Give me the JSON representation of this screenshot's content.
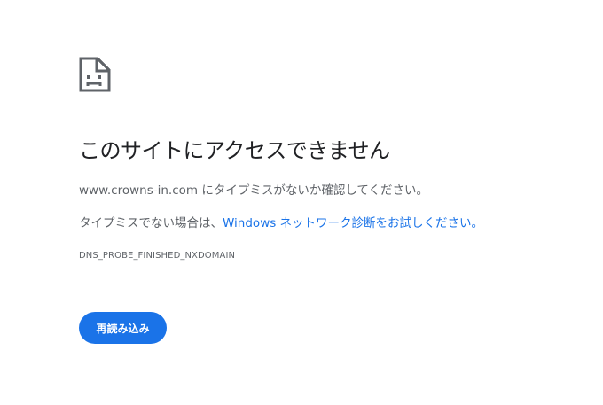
{
  "icon": "sad-page-icon",
  "title": "このサイトにアクセスできません",
  "message": {
    "domain_text": "www.crowns-in.com にタイプミスがないか確認してください。",
    "suggestion_prefix": "タイプミスでない場合は、",
    "suggestion_link": "Windows ネットワーク診断をお試しください。"
  },
  "error_code": "DNS_PROBE_FINISHED_NXDOMAIN",
  "reload_button": {
    "label": "再読み込み"
  },
  "colors": {
    "accent": "#1a73e8",
    "text": "#5f6368",
    "title": "#202124"
  }
}
